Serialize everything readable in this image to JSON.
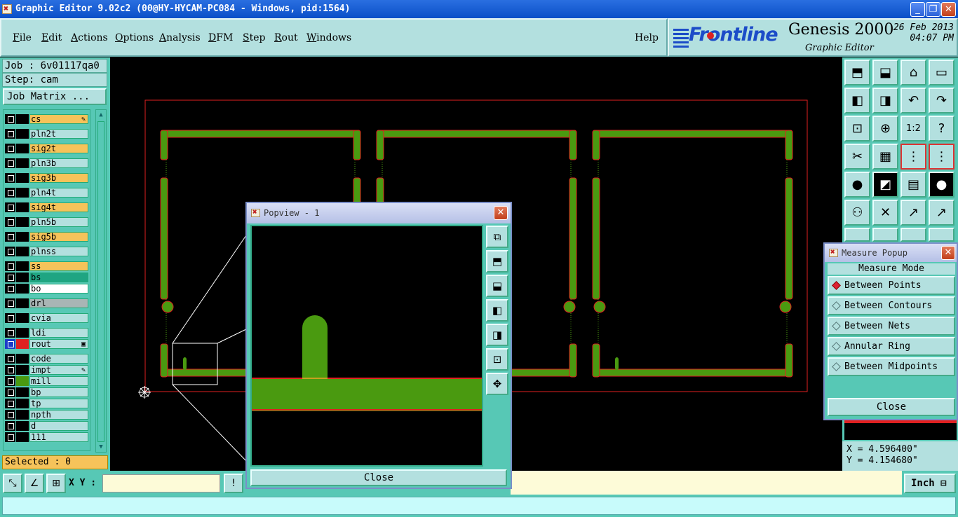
{
  "window": {
    "title": "Graphic Editor 9.02c2 (00@HY-HYCAM-PC084 - Windows, pid:1564)",
    "minimize": "_",
    "maximize": "❐",
    "close": "✕"
  },
  "menu": {
    "items": [
      {
        "first": "F",
        "rest": "ile"
      },
      {
        "first": "E",
        "rest": "dit"
      },
      {
        "first": "A",
        "rest": "ctions"
      },
      {
        "first": "O",
        "rest": "ptions"
      },
      {
        "first": "A",
        "rest": "nalysis"
      },
      {
        "first": "D",
        "rest": "FM"
      },
      {
        "first": "S",
        "rest": "tep"
      },
      {
        "first": "R",
        "rest": "out"
      },
      {
        "first": "W",
        "rest": "indows"
      }
    ],
    "help": "Help"
  },
  "brand": {
    "logo": "Frontline",
    "product": "Genesis 2000",
    "subtitle": "Graphic Editor",
    "date": "26 Feb 2013",
    "time": "04:07 PM"
  },
  "left": {
    "job": "Job : 6v01117qa0",
    "step": "Step: cam",
    "job_matrix": "Job Matrix ...",
    "selected": "Selected : 0"
  },
  "layers": [
    {
      "name": "cs",
      "color": "#f6c35a",
      "mark": "✎"
    },
    {
      "name": "pln2t",
      "color": "#b3e0df"
    },
    {
      "name": "sig2t",
      "color": "#f6c35a"
    },
    {
      "name": "pln3b",
      "color": "#b3e0df"
    },
    {
      "name": "sig3b",
      "color": "#f6c35a"
    },
    {
      "name": "pln4t",
      "color": "#b3e0df"
    },
    {
      "name": "sig4t",
      "color": "#f6c35a"
    },
    {
      "name": "pln5b",
      "color": "#b3e0df"
    },
    {
      "name": "sig5b",
      "color": "#f6c35a"
    },
    {
      "name": "plnss",
      "color": "#b3e0df"
    },
    {
      "name": "ss",
      "color": "#f6c35a"
    },
    {
      "name": "bs",
      "color": "#1fa582"
    },
    {
      "name": "bo",
      "color": "#ffffff"
    },
    {
      "name": "drl",
      "color": "#a9b5b5"
    },
    {
      "name": "cvia",
      "color": "#b3e0df"
    },
    {
      "name": "ldi",
      "color": "#b3e0df"
    },
    {
      "name": "rout",
      "color": "#b3e0df",
      "mark": "▣"
    },
    {
      "name": "code",
      "color": "#b3e0df"
    },
    {
      "name": "impt",
      "color": "#b3e0df",
      "mark": "✎"
    },
    {
      "name": "mill",
      "color": "#b3e0df"
    },
    {
      "name": "bp",
      "color": "#b3e0df"
    },
    {
      "name": "tp",
      "color": "#b3e0df"
    },
    {
      "name": "npth",
      "color": "#b3e0df"
    },
    {
      "name": "d",
      "color": "#b3e0df"
    },
    {
      "name": "111",
      "color": "#b3e0df"
    }
  ],
  "toolbar_icons": [
    "zoom-home-icon",
    "zoom-out-icon",
    "home-icon",
    "window-xy-icon",
    "pan-left-icon",
    "pan-right-icon",
    "undo-icon",
    "redo-icon",
    "fit-all-icon",
    "zoom-center-icon",
    "ratio-icon",
    "help-icon",
    "settings-icon",
    "grid-icon",
    "snap-icon",
    "snap-alt-icon",
    "pad-icon",
    "measure-icon",
    "ruler-icon",
    "circle-icon",
    "net-icon",
    "cross-icon",
    "point-icon",
    "point-alt-icon"
  ],
  "toolbar_glyphs": {
    "ratio": "1:2",
    "help": "?"
  },
  "coords": {
    "x": "X = 4.596400\"",
    "y": "Y = 4.154680\""
  },
  "bottom": {
    "xy_label": "X Y :",
    "xy_value": "",
    "warn": "!",
    "unit": "Inch"
  },
  "popview": {
    "title": "Popview - 1",
    "close": "Close"
  },
  "measure": {
    "title": "Measure Popup",
    "mode_label": "Measure Mode",
    "options": [
      "Between Points",
      "Between Contours",
      "Between Nets",
      "Annular Ring",
      "Between Midpoints"
    ],
    "selected_index": 0,
    "close": "Close"
  },
  "colors": {
    "teal": "#57c8b5",
    "light_teal": "#b3e0df",
    "layer_orange": "#f6c35a",
    "board_green": "#4a9a10",
    "outline_red": "#e02020"
  }
}
